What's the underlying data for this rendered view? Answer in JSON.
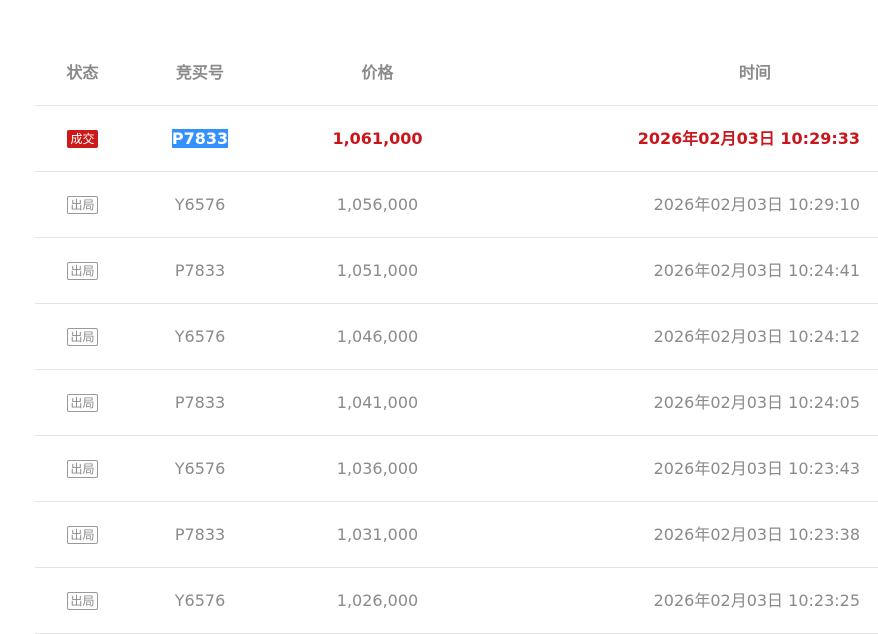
{
  "table": {
    "headers": {
      "status": "状态",
      "bidder": "竞买号",
      "price": "价格",
      "time": "时间"
    },
    "rows": [
      {
        "status": "成交",
        "bidder": "P7833",
        "price": "1,061,000",
        "time": "2026年02月03日 10:29:33"
      },
      {
        "status": "出局",
        "bidder": "Y6576",
        "price": "1,056,000",
        "time": "2026年02月03日 10:29:10"
      },
      {
        "status": "出局",
        "bidder": "P7833",
        "price": "1,051,000",
        "time": "2026年02月03日 10:24:41"
      },
      {
        "status": "出局",
        "bidder": "Y6576",
        "price": "1,046,000",
        "time": "2026年02月03日 10:24:12"
      },
      {
        "status": "出局",
        "bidder": "P7833",
        "price": "1,041,000",
        "time": "2026年02月03日 10:24:05"
      },
      {
        "status": "出局",
        "bidder": "Y6576",
        "price": "1,036,000",
        "time": "2026年02月03日 10:23:43"
      },
      {
        "status": "出局",
        "bidder": "P7833",
        "price": "1,031,000",
        "time": "2026年02月03日 10:23:38"
      },
      {
        "status": "出局",
        "bidder": "Y6576",
        "price": "1,026,000",
        "time": "2026年02月03日 10:23:25"
      }
    ]
  },
  "colors": {
    "deal_red": "#c8171c",
    "muted_text": "#8a8a8a",
    "selection_blue": "#3390ff"
  }
}
